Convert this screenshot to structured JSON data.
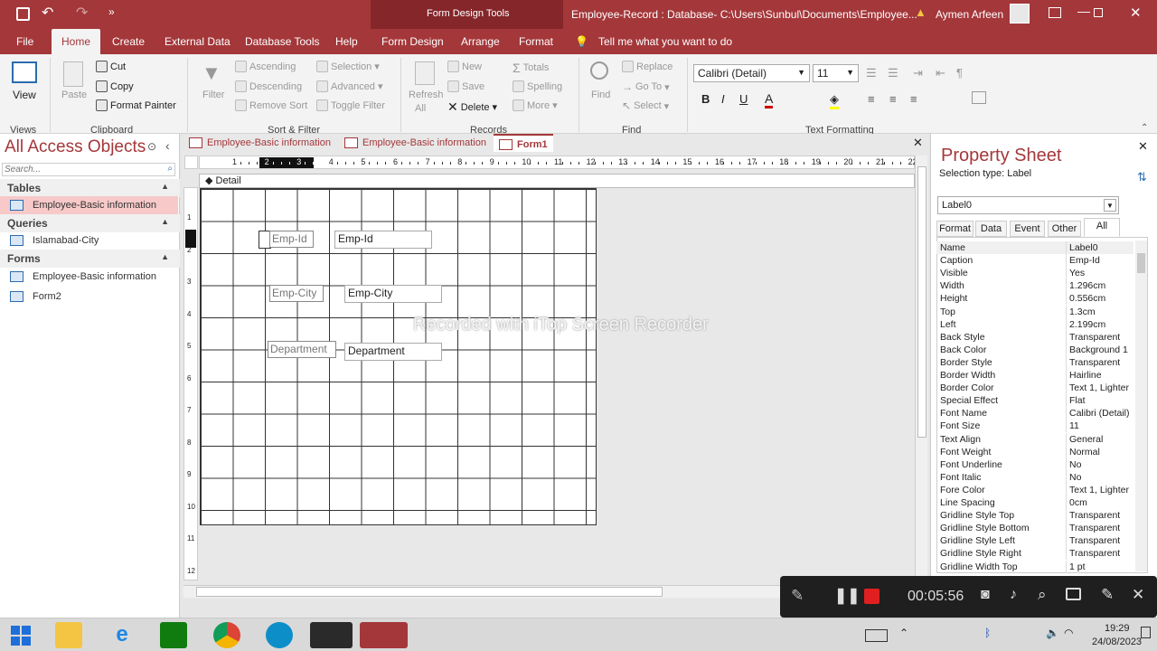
{
  "titlebar": {
    "contextual_group": "Form Design Tools",
    "title": "Employee-Record : Database- C:\\Users\\Sunbul\\Documents\\Employee...",
    "user": "Aymen Arfeen",
    "warning_icon": "warning-icon"
  },
  "tabs": [
    "File",
    "Home",
    "Create",
    "External Data",
    "Database Tools",
    "Help",
    "Form Design",
    "Arrange",
    "Format"
  ],
  "tell_me": "Tell me what you want to do",
  "ribbon": {
    "views": {
      "view": "View",
      "group": "Views"
    },
    "clipboard": {
      "paste": "Paste",
      "cut": "Cut",
      "copy": "Copy",
      "format_painter": "Format Painter",
      "group": "Clipboard"
    },
    "sort_filter": {
      "filter": "Filter",
      "ascending": "Ascending",
      "descending": "Descending",
      "remove_sort": "Remove Sort",
      "selection": "Selection",
      "advanced": "Advanced",
      "toggle_filter": "Toggle Filter",
      "group": "Sort & Filter"
    },
    "records": {
      "refresh": "Refresh",
      "all": "All",
      "new": "New",
      "save": "Save",
      "delete": "Delete",
      "totals": "Totals",
      "spelling": "Spelling",
      "more": "More",
      "group": "Records"
    },
    "find": {
      "find": "Find",
      "replace": "Replace",
      "goto": "Go To",
      "select": "Select",
      "group": "Find"
    },
    "text": {
      "font": "Calibri (Detail)",
      "size": "11",
      "group": "Text Formatting",
      "bold": "B",
      "italic": "I",
      "underline": "U",
      "font_color": "A"
    }
  },
  "nav": {
    "title": "All Access Objects",
    "search_placeholder": "Search...",
    "sections": [
      {
        "label": "Tables",
        "items": [
          "Employee-Basic information"
        ]
      },
      {
        "label": "Queries",
        "items": [
          "Islamabad-City"
        ]
      },
      {
        "label": "Forms",
        "items": [
          "Employee-Basic information",
          "Form2"
        ]
      }
    ]
  },
  "doc_tabs": [
    "Employee-Basic information",
    "Employee-Basic information",
    "Form1"
  ],
  "ruler_h": [
    "1",
    "2",
    "3",
    "4",
    "5",
    "6",
    "7",
    "8",
    "9",
    "10",
    "11",
    "12",
    "13",
    "14",
    "15",
    "16",
    "17",
    "18",
    "19",
    "20",
    "21",
    "22"
  ],
  "ruler_v": [
    "1",
    "2",
    "3",
    "4",
    "5",
    "6",
    "7",
    "8",
    "9",
    "10",
    "11",
    "12"
  ],
  "detail_label": "Detail",
  "form": {
    "labels": [
      "Emp-Id",
      "Emp-City",
      "Department"
    ],
    "textboxes": [
      "Emp-Id",
      "Emp-City",
      "Department"
    ]
  },
  "watermark": "Recorded with iTop Screen Recorder",
  "property_sheet": {
    "title": "Property Sheet",
    "selection_type": "Selection type:  Label",
    "selected": "Label0",
    "tabs": [
      "Format",
      "Data",
      "Event",
      "Other",
      "All"
    ],
    "rows": [
      [
        "Name",
        "Label0"
      ],
      [
        "Caption",
        "Emp-Id"
      ],
      [
        "Visible",
        "Yes"
      ],
      [
        "Width",
        "1.296cm"
      ],
      [
        "Height",
        "0.556cm"
      ],
      [
        "Top",
        "1.3cm"
      ],
      [
        "Left",
        "2.199cm"
      ],
      [
        "Back Style",
        "Transparent"
      ],
      [
        "Back Color",
        "Background 1"
      ],
      [
        "Border Style",
        "Transparent"
      ],
      [
        "Border Width",
        "Hairline"
      ],
      [
        "Border Color",
        "Text 1, Lighter"
      ],
      [
        "Special Effect",
        "Flat"
      ],
      [
        "Font Name",
        "Calibri (Detail)"
      ],
      [
        "Font Size",
        "11"
      ],
      [
        "Text Align",
        "General"
      ],
      [
        "Font Weight",
        "Normal"
      ],
      [
        "Font Underline",
        "No"
      ],
      [
        "Font Italic",
        "No"
      ],
      [
        "Fore Color",
        "Text 1, Lighter"
      ],
      [
        "Line Spacing",
        "0cm"
      ],
      [
        "Gridline Style Top",
        "Transparent"
      ],
      [
        "Gridline Style Bottom",
        "Transparent"
      ],
      [
        "Gridline Style Left",
        "Transparent"
      ],
      [
        "Gridline Style Right",
        "Transparent"
      ],
      [
        "Gridline Width Top",
        "1 pt"
      ]
    ]
  },
  "recorder": {
    "time": "00:05:56"
  },
  "taskbar": {
    "time": "19:29",
    "date": "24/08/2023"
  },
  "colors": {
    "accent": "#a4373a",
    "contextual": "#85262a",
    "selected_nav": "#f7c9c9"
  }
}
